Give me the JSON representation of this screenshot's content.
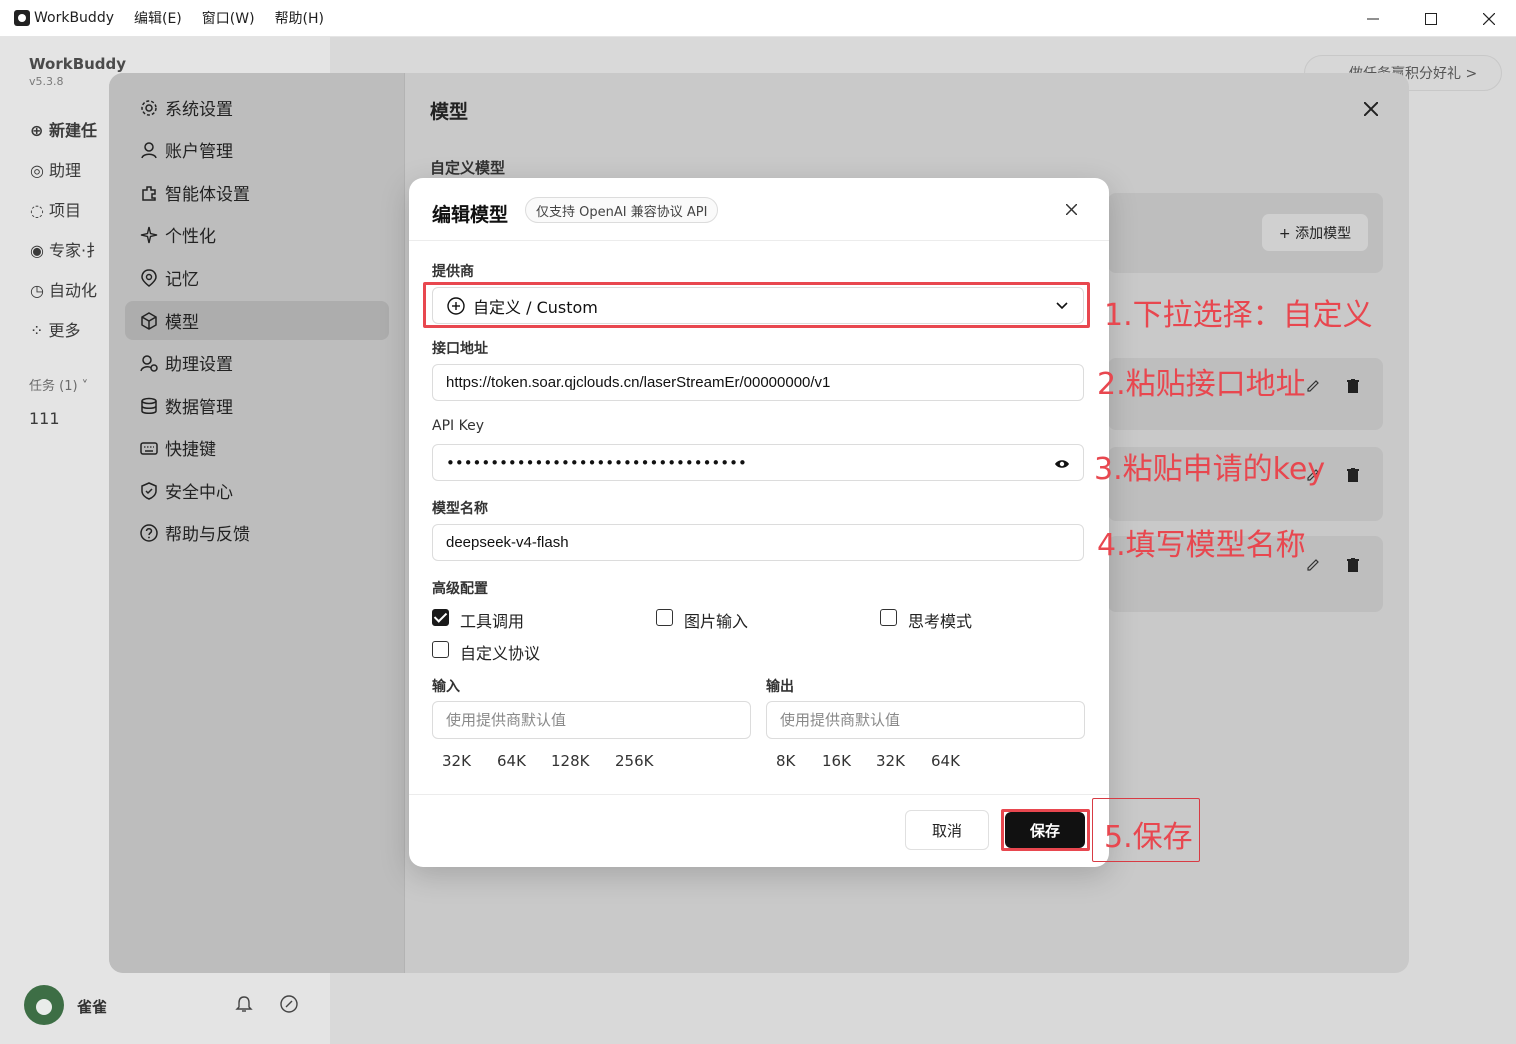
{
  "titlebar": {
    "app_name": "WorkBuddy",
    "menu": [
      "编辑(E)",
      "窗口(W)",
      "帮助(H)"
    ],
    "min": "—",
    "max": "☐",
    "close": "✕"
  },
  "app": {
    "brand": "WorkBuddy",
    "version": "v5.3.8",
    "sidebar": [
      {
        "label": "新建任",
        "icon": "plus-circle-icon"
      },
      {
        "label": "助理",
        "icon": "assistant-icon"
      },
      {
        "label": "项目",
        "icon": "folder-icon"
      },
      {
        "label": "专家·扌",
        "icon": "expert-icon"
      },
      {
        "label": "自动化",
        "icon": "clock-icon"
      },
      {
        "label": "更多",
        "icon": "grid-icon"
      }
    ],
    "tasks_label": "任务 (1) ˅",
    "task_item": "111",
    "promo": "做任务赢积分好礼 >",
    "user_name": "雀雀"
  },
  "settings": {
    "nav": [
      {
        "label": "系统设置",
        "icon": "gear-icon"
      },
      {
        "label": "账户管理",
        "icon": "user-icon"
      },
      {
        "label": "智能体设置",
        "icon": "puzzle-icon"
      },
      {
        "label": "个性化",
        "icon": "sparkle-icon"
      },
      {
        "label": "记忆",
        "icon": "memory-icon"
      },
      {
        "label": "模型",
        "icon": "cube-icon"
      },
      {
        "label": "助理设置",
        "icon": "user-gear-icon"
      },
      {
        "label": "数据管理",
        "icon": "database-icon"
      },
      {
        "label": "快捷键",
        "icon": "keyboard-icon"
      },
      {
        "label": "安全中心",
        "icon": "shield-icon"
      },
      {
        "label": "帮助与反馈",
        "icon": "help-icon"
      }
    ],
    "active_index": 5,
    "title": "模型",
    "close": "✕",
    "custom_heading": "自定义模型",
    "add_model": "+ 添加模型"
  },
  "dialog": {
    "title": "编辑模型",
    "tag": "仅支持 OpenAI 兼容协议 API",
    "close": "✕",
    "provider_label": "提供商",
    "provider_value": "自定义 / Custom",
    "endpoint_label": "接口地址",
    "endpoint_value": "https://token.soar.qjclouds.cn/laserStreamEr/00000000/v1",
    "apikey_label": "API Key",
    "apikey_value": "••••••••••••••••••••••••••••••••••",
    "model_name_label": "模型名称",
    "model_name_value": "deepseek-v4-flash",
    "advanced_label": "高级配置",
    "checkboxes": [
      {
        "label": "工具调用",
        "checked": true
      },
      {
        "label": "图片输入",
        "checked": false
      },
      {
        "label": "思考模式",
        "checked": false
      },
      {
        "label": "自定义协议",
        "checked": false
      }
    ],
    "input_label": "输入",
    "output_label": "输出",
    "input_placeholder": "使用提供商默认值",
    "output_placeholder": "使用提供商默认值",
    "input_chips": [
      "32K",
      "64K",
      "128K",
      "256K"
    ],
    "output_chips": [
      "8K",
      "16K",
      "32K",
      "64K"
    ],
    "cancel": "取消",
    "save": "保存"
  },
  "annotations": {
    "color": "#e8474f",
    "notes": [
      "1.下拉选择：自定义",
      "2.粘贴接口地址",
      "3.粘贴申请的key",
      "4.填写模型名称",
      "5.保存"
    ]
  }
}
